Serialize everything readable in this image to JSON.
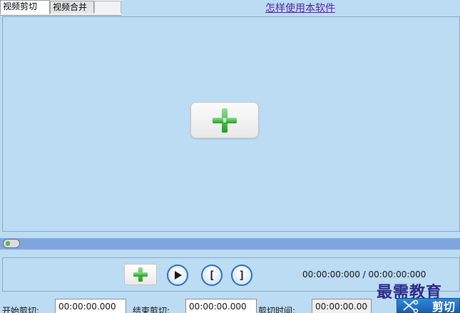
{
  "tabs": [
    {
      "label": "视频剪切",
      "active": true
    },
    {
      "label": "视频合并",
      "active": false
    }
  ],
  "help_link": "怎样使用本软件",
  "preview": {
    "add_icon": "plus-icon"
  },
  "timeline": {
    "position_fraction": 0.0
  },
  "controls": {
    "add_icon": "plus-icon",
    "play_icon": "play-icon",
    "mark_in_label": "[",
    "mark_out_label": "]",
    "time_readout": "00:00:00:000 / 00:00:00:000"
  },
  "fields": {
    "start_label": "开始剪切:",
    "start_value": "00:00:00.000",
    "end_label": "结束剪切:",
    "end_value": "00:00:00.000",
    "duration_label": "剪切时间:",
    "duration_value": "00:00:00.000"
  },
  "cut_button": {
    "label": "剪切",
    "icon": "scissors-icon"
  },
  "watermark": "最需教育",
  "colors": {
    "background": "#bcdcf4",
    "timeline": "#7ea5de",
    "accent_green": "#3cba3c",
    "link": "#4c2a9c",
    "button_blue": "#2f88d9"
  }
}
